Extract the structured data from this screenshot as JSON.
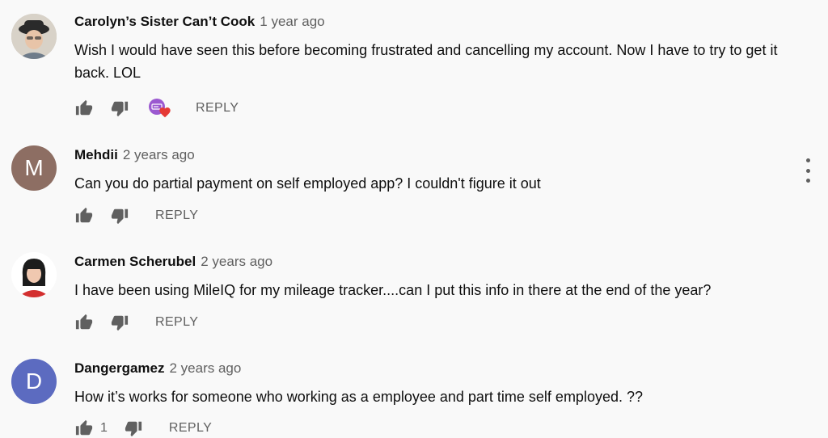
{
  "comments": [
    {
      "author": "Carolyn’s Sister Can’t Cook",
      "time": "1 year ago",
      "text": "Wish I would have seen this before becoming frustrated and cancelling my account. Now I have to try to get it back. LOL",
      "avatar_type": "photo-hat",
      "creator_heart": true,
      "reply_label": "REPLY"
    },
    {
      "author": "Mehdii",
      "time": "2 years ago",
      "text": "Can you do partial payment on self employed app? I couldn't figure it out",
      "avatar_letter": "M",
      "avatar_color": "#8d6e63",
      "reply_label": "REPLY"
    },
    {
      "author": "Carmen Scherubel",
      "time": "2 years ago",
      "text": "I have been using MileIQ for my mileage tracker....can I put this info in there at the end of the year?",
      "avatar_type": "photo-woman",
      "reply_label": "REPLY"
    },
    {
      "author": "Dangergamez",
      "time": "2 years ago",
      "text": "How it’s works for someone who working as a employee and part time self employed. ??",
      "avatar_letter": "D",
      "avatar_color": "#5c6bc0",
      "like_count": "1",
      "reply_label": "REPLY"
    }
  ],
  "icons": {
    "like": "thumb-up-icon",
    "dislike": "thumb-down-icon",
    "more": "more-vert-icon",
    "heart": "creator-heart-icon"
  },
  "colors": {
    "background": "#f9f9f9",
    "secondary_text": "#606060",
    "heart": "#e53935"
  }
}
